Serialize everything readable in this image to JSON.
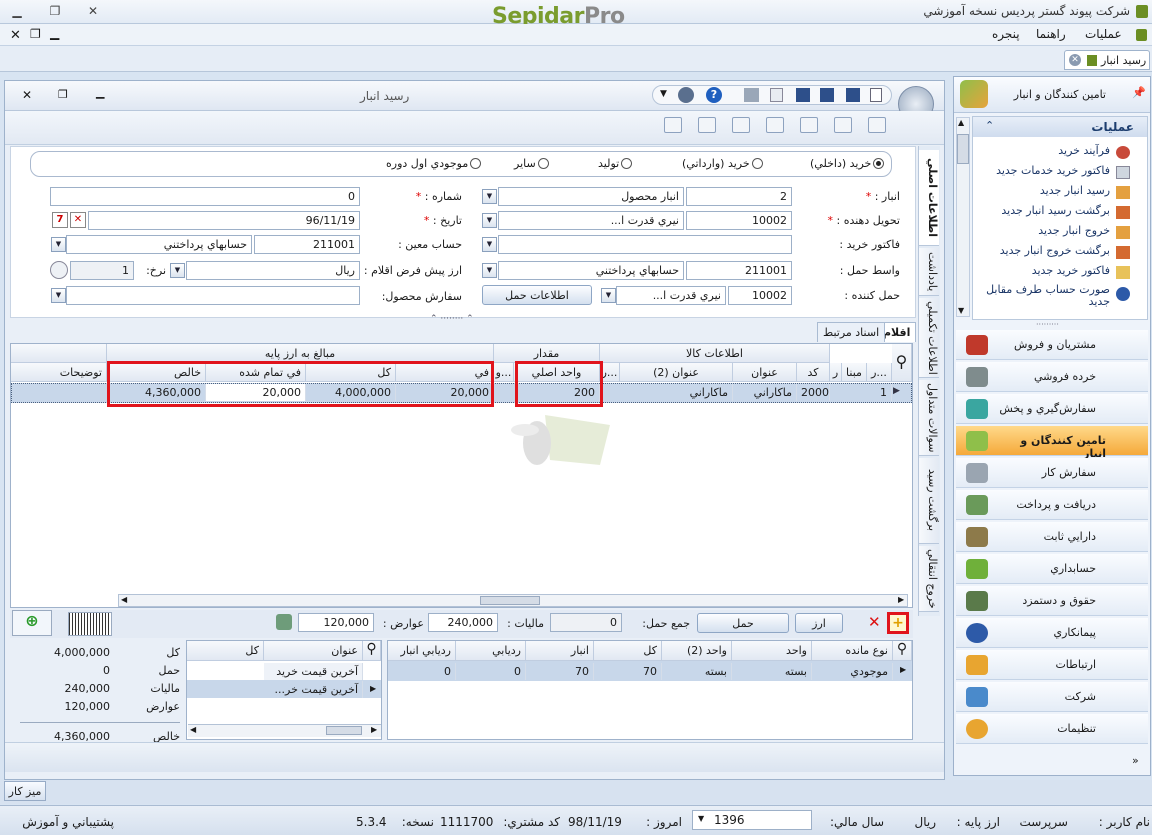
{
  "app": {
    "company_title": "شرکت پیوند گستر پردیس نسخه آموزشي",
    "logo_a": "Sepidar",
    "logo_b": "Pro"
  },
  "menu": {
    "items": [
      "عمليات",
      "راهنما",
      "پنجره"
    ]
  },
  "tab": {
    "label": "رسيد انبار"
  },
  "window": {
    "title": "رسيد انبار"
  },
  "form": {
    "radios": [
      {
        "label": "خريد (داخلي)",
        "checked": true
      },
      {
        "label": "خريد (وارداتي)",
        "checked": false
      },
      {
        "label": "توليد",
        "checked": false
      },
      {
        "label": "ساير",
        "checked": false
      },
      {
        "label": "موجودي اول دوره",
        "checked": false
      }
    ],
    "anbar_label": "انبار :",
    "anbar_code": "2",
    "anbar_name": "انبار محصول",
    "tahvil_label": "تحويل دهنده :",
    "tahvil_code": "10002",
    "tahvil_name": "نيري قدرت ا...",
    "factor_label": "فاكتور خريد :",
    "vaset_label": "واسط حمل :",
    "vaset_code": "211001",
    "vaset_name": "حسابهاي پرداختني",
    "haml_label": "حمل كننده :",
    "haml_code": "10002",
    "haml_name": "نيري قدرت ا...",
    "haml_info_btn": "اطلاعات حمل",
    "shomare_label": "شماره :",
    "shomare": "0",
    "tarikh_label": "تاريخ :",
    "tarikh": "96/11/19",
    "hesab_label": "حساب معين :",
    "hesab_code": "211001",
    "hesab_name": "حسابهاي پرداختني",
    "arz_label": "ارز پيش فرض اقلام :",
    "arz_value": "ريال",
    "nerkh_label": "نرخ:",
    "nerkh_value": "1",
    "sefaresh_label": "سفارش محصول:"
  },
  "vtabs": [
    "اطلاعات اصلي",
    "يادداشت",
    "اطلاعات تكميلي",
    "سوالات متداول",
    "برگشت رسيد",
    "خروج انتقالي"
  ],
  "items_tabs": [
    "اقلام",
    "اسناد مرتبط"
  ],
  "grid": {
    "group_headers": {
      "kala": "اطلاعات كالا",
      "meghdar": "مقدار",
      "mabalegh": "مبالغ به ارز پايه"
    },
    "headers": [
      "ر...",
      "مبنا",
      "ر",
      "كد",
      "عنوان",
      "عنوان (2)",
      "ر...",
      "واحد اصلي",
      "و...",
      "في",
      "كل",
      "في تمام شده",
      "خالص",
      "توضيحات"
    ],
    "row": {
      "radif": "1",
      "code": "2000",
      "title": "ماكاراني",
      "title2": "ماكاراني",
      "vahed_asli": "200",
      "fee": "20,000",
      "kol": "4,000,000",
      "fee_tamam": "20,000",
      "khales": "4,360,000"
    }
  },
  "bottom_bar": {
    "haml_btn": "حمل",
    "arz_btn": "ارز",
    "jam_haml_label": "جمع حمل:",
    "jam_haml": "0",
    "maliat_label": "ماليات :",
    "maliat": "240,000",
    "avarez_label": "عوارض :",
    "avarez": "120,000"
  },
  "lower_grid": {
    "headers": [
      "نوع مانده",
      "واحد",
      "واحد (2)",
      "كل",
      "انبار",
      "رديابي",
      "رديابي انبار"
    ],
    "row": [
      "موجودي",
      "بسته",
      "بسته",
      "70",
      "70",
      "0",
      "0"
    ]
  },
  "mid_grid": {
    "headers": [
      "عنوان",
      "كل"
    ],
    "rows": [
      "آخرين قيمت خريد",
      "آخرين قيمت خر..."
    ]
  },
  "summary": [
    {
      "label": "كل",
      "value": "4,000,000"
    },
    {
      "label": "حمل",
      "value": "0"
    },
    {
      "label": "ماليات",
      "value": "240,000"
    },
    {
      "label": "عوارض",
      "value": "120,000"
    },
    {
      "label": "خالص",
      "value": "4,360,000"
    }
  ],
  "nav": {
    "header": "تامين كنندگان و انبار",
    "ops_title": "عمليات",
    "ops": [
      "فرآيند خريد",
      "فاكتور خريد خدمات جديد",
      "رسيد انبار جديد",
      "برگشت رسيد انبار جديد",
      "خروج انبار جديد",
      "برگشت خروج انبار جديد",
      "فاكتور خريد جديد",
      "صورت حساب طرف مقابل جديد"
    ],
    "modules": [
      {
        "label": "مشتريان و فروش",
        "active": false
      },
      {
        "label": "خرده فروشي",
        "active": false
      },
      {
        "label": "سفارش‌گيري و پخش",
        "active": false
      },
      {
        "label": "تامين كنندگان و انبار",
        "active": true
      },
      {
        "label": "سفارش كار",
        "active": false
      },
      {
        "label": "دريافت و پرداخت",
        "active": false
      },
      {
        "label": "دارايي ثابت",
        "active": false
      },
      {
        "label": "حسابداري",
        "active": false
      },
      {
        "label": "حقوق و دستمزد",
        "active": false
      },
      {
        "label": "پيمانكاري",
        "active": false
      },
      {
        "label": "ارتباطات",
        "active": false
      },
      {
        "label": "شركت",
        "active": false
      },
      {
        "label": "تنظيمات",
        "active": false
      }
    ]
  },
  "desk": {
    "label": "ميز كار"
  },
  "status": {
    "user_label": "نام كاربر :",
    "user": "سرپرست",
    "base_currency_label": "ارز پايه :",
    "base_currency": "ريال",
    "fiscal_year_label": "سال مالي:",
    "fiscal_year": "1396",
    "today_label": "امروز :",
    "today": "98/11/19",
    "customer_code_label": "كد مشتري:",
    "customer_code": "1111700",
    "version_label": "نسخه:",
    "version": "5.3.4",
    "support": "پشتيباني و آموزش"
  }
}
